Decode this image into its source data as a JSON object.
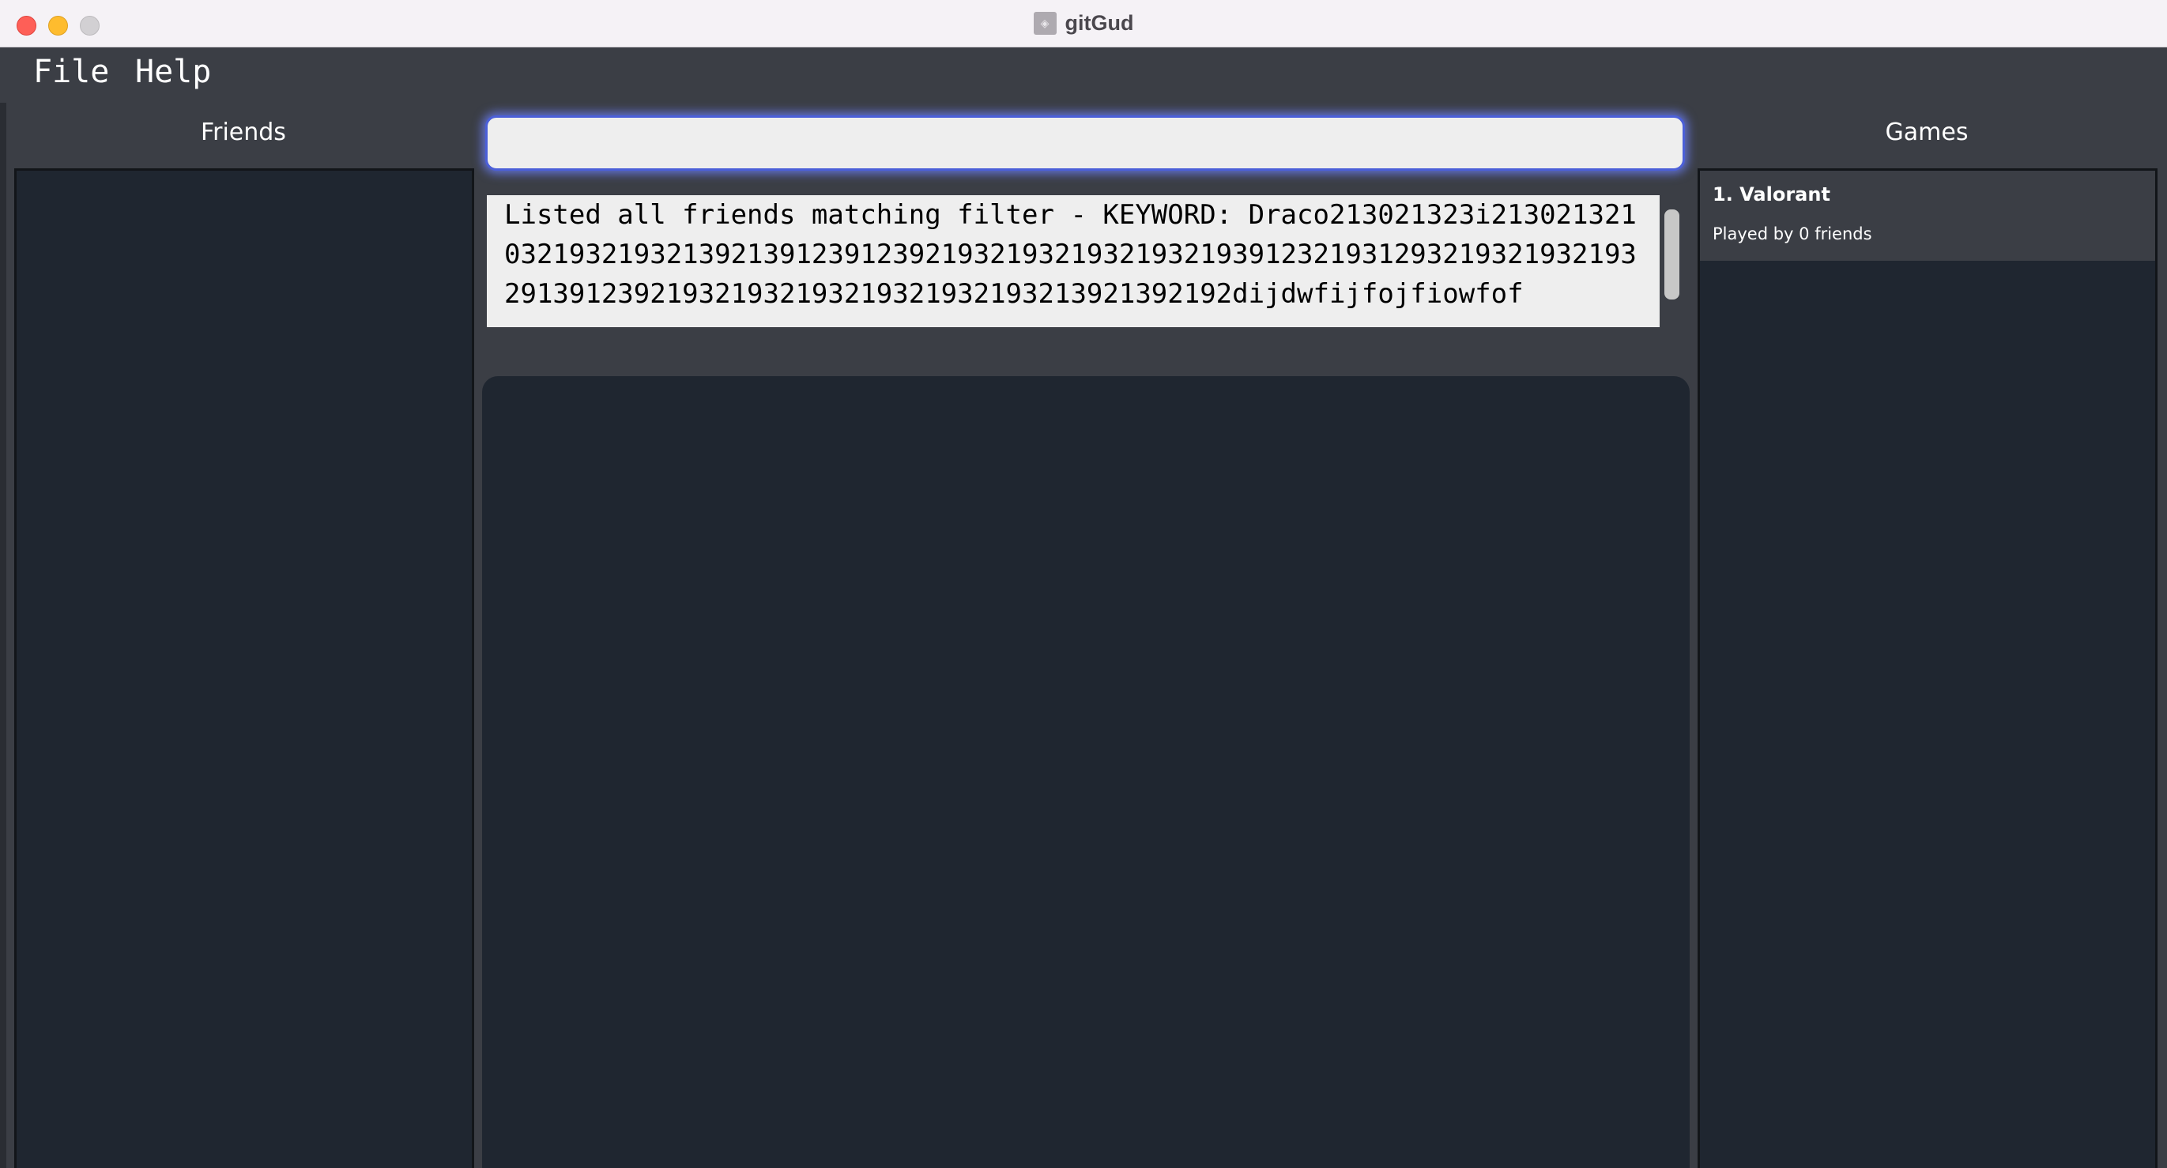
{
  "window": {
    "title": "gitGud",
    "app_icon": "app-icon"
  },
  "menu": {
    "file": "File",
    "help": "Help"
  },
  "friends": {
    "title": "Friends",
    "items": []
  },
  "command": {
    "value": "",
    "placeholder": ""
  },
  "result": {
    "text": "Listed all friends matching filter - KEYWORD: Draco213021323i2130213210321932193213921391239123921932193219321932193912321931293219321932193291391239219321932193219321932193213921392192dijdwfijfojfiowfof"
  },
  "games": {
    "title": "Games",
    "items": [
      {
        "name": "1. Valorant",
        "subtitle": "Played by 0 friends"
      }
    ]
  },
  "colors": {
    "background": "#3b3e45",
    "list_background": "#1f2630",
    "command_border": "#4b5fd8",
    "close": "#fe5f57",
    "minimize": "#febc2e",
    "zoom": "#d2d0d3"
  }
}
